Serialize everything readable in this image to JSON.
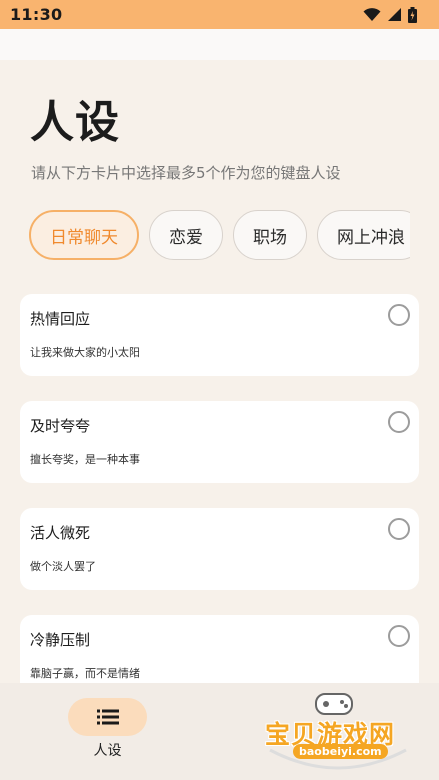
{
  "status_bar": {
    "time": "11:30"
  },
  "page": {
    "title": "人设",
    "subtitle": "请从下方卡片中选择最多5个作为您的键盘人设"
  },
  "tabs": [
    {
      "label": "日常聊天",
      "active": true
    },
    {
      "label": "恋爱",
      "active": false
    },
    {
      "label": "职场",
      "active": false
    },
    {
      "label": "网上冲浪",
      "active": false
    }
  ],
  "cards": [
    {
      "title": "热情回应",
      "desc": "让我来做大家的小太阳",
      "selected": false
    },
    {
      "title": "及时夸夸",
      "desc": "擅长夸奖，是一种本事",
      "selected": false
    },
    {
      "title": "活人微死",
      "desc": "做个淡人罢了",
      "selected": false
    },
    {
      "title": "冷静压制",
      "desc": "靠脑子赢，而不是情绪",
      "selected": false
    }
  ],
  "bottom_nav": {
    "item_label": "人设",
    "item_icon": "list-icon"
  },
  "watermark": {
    "title": "宝贝游戏网",
    "url": "baobeiyi.com"
  },
  "colors": {
    "accent": "#f08a2e",
    "status_bar": "#f9b46f",
    "background": "#f7f1ea",
    "nav_pill": "#fbdcbc"
  }
}
